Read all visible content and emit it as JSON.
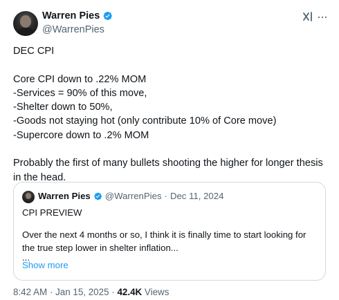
{
  "author": {
    "name": "Warren Pies",
    "handle": "@WarrenPies"
  },
  "post_text": [
    "DEC CPI",
    "",
    "Core CPI down to .22% MOM",
    "-Services = 90% of this move,",
    "-Shelter down to 50%,",
    "-Goods not staying hot (only contribute 10% of Core move)",
    "-Supercore down to .2% MOM",
    "",
    "Probably the first of many bullets shooting the higher for longer thesis in the head."
  ],
  "quoted": {
    "name": "Warren Pies",
    "handle": "@WarrenPies",
    "separator": "·",
    "date": "Dec 11, 2024",
    "title": "CPI PREVIEW",
    "body": "Over the next 4 months or so, I think it is finally time to start looking for the true step lower in shelter inflation...",
    "ellipsis": "...",
    "show_more": "Show more"
  },
  "meta": {
    "time": "8:42 AM",
    "separator": "·",
    "date": "Jan 15, 2025",
    "views_count": "42.4K",
    "views_label": "Views"
  },
  "icons": {
    "verified": "verified-badge-icon",
    "grok": "grok-icon",
    "more": "more-icon"
  },
  "colors": {
    "verified": "#1d9bf0",
    "link": "#1d9bf0",
    "secondary_text": "#536471",
    "border": "#cfd9de"
  }
}
